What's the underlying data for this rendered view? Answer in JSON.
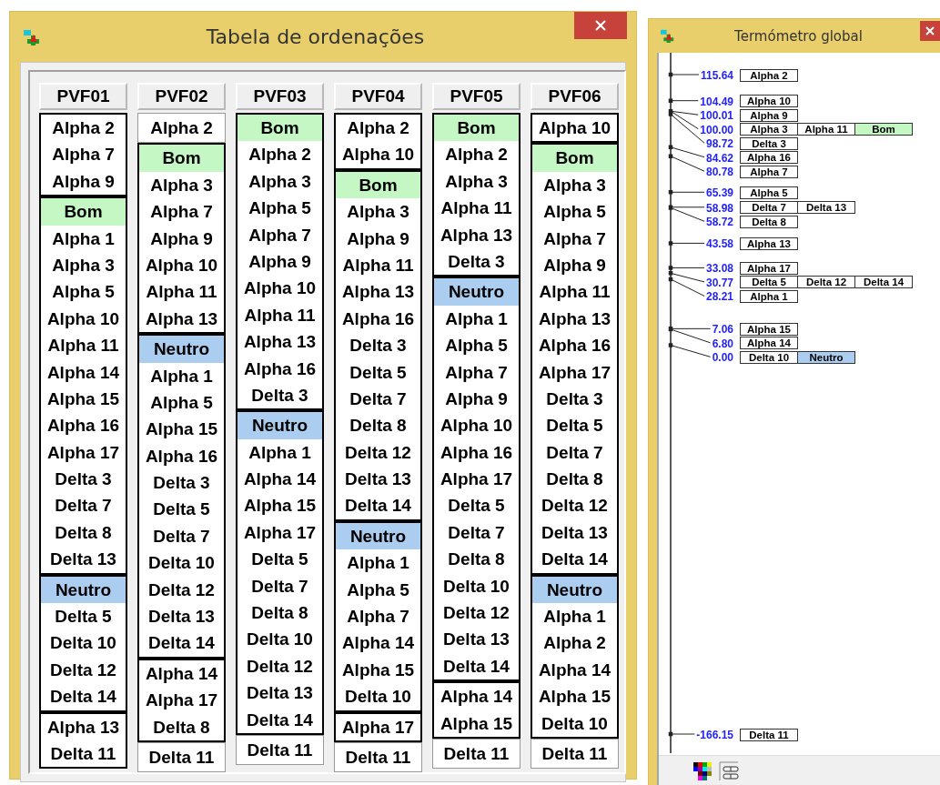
{
  "ordering_window": {
    "title": "Tabela de ordenações",
    "columns": [
      {
        "header": "PVF01",
        "groups": [
          {
            "boxed": true,
            "items": [
              {
                "label": "Alpha 2"
              },
              {
                "label": "Alpha 7"
              },
              {
                "label": "Alpha 9"
              }
            ]
          },
          {
            "boxed": true,
            "items": [
              {
                "label": "Bom",
                "color": "#c4f7c4"
              },
              {
                "label": "Alpha 1"
              },
              {
                "label": "Alpha 3"
              },
              {
                "label": "Alpha 5"
              },
              {
                "label": "Alpha 10"
              },
              {
                "label": "Alpha 11"
              },
              {
                "label": "Alpha 14"
              },
              {
                "label": "Alpha 15"
              },
              {
                "label": "Alpha 16"
              },
              {
                "label": "Alpha 17"
              },
              {
                "label": "Delta 3"
              },
              {
                "label": "Delta 7"
              },
              {
                "label": "Delta 8"
              },
              {
                "label": "Delta 13"
              }
            ]
          },
          {
            "boxed": true,
            "items": [
              {
                "label": "Neutro",
                "color": "#aacdf0"
              },
              {
                "label": "Delta 5"
              },
              {
                "label": "Delta 10"
              },
              {
                "label": "Delta 12"
              },
              {
                "label": "Delta 14"
              }
            ]
          },
          {
            "boxed": true,
            "items": [
              {
                "label": "Alpha 13"
              },
              {
                "label": "Delta 11"
              }
            ]
          }
        ]
      },
      {
        "header": "PVF02",
        "groups": [
          {
            "boxed": false,
            "items": [
              {
                "label": "Alpha 2"
              }
            ]
          },
          {
            "boxed": true,
            "items": [
              {
                "label": "Bom",
                "color": "#c4f7c4"
              },
              {
                "label": "Alpha 3"
              },
              {
                "label": "Alpha 7"
              },
              {
                "label": "Alpha 9"
              },
              {
                "label": "Alpha 10"
              },
              {
                "label": "Alpha 11"
              },
              {
                "label": "Alpha 13"
              }
            ]
          },
          {
            "boxed": true,
            "items": [
              {
                "label": "Neutro",
                "color": "#aacdf0"
              },
              {
                "label": "Alpha 1"
              },
              {
                "label": "Alpha 5"
              },
              {
                "label": "Alpha 15"
              },
              {
                "label": "Alpha 16"
              },
              {
                "label": "Delta 3"
              },
              {
                "label": "Delta 5"
              },
              {
                "label": "Delta 7"
              },
              {
                "label": "Delta 10"
              },
              {
                "label": "Delta 12"
              },
              {
                "label": "Delta 13"
              },
              {
                "label": "Delta 14"
              }
            ]
          },
          {
            "boxed": true,
            "items": [
              {
                "label": "Alpha 14"
              },
              {
                "label": "Alpha 17"
              },
              {
                "label": "Delta 8"
              }
            ]
          },
          {
            "boxed": false,
            "items": [
              {
                "label": "Delta 11"
              }
            ]
          }
        ]
      },
      {
        "header": "PVF03",
        "groups": [
          {
            "boxed": true,
            "items": [
              {
                "label": "Bom",
                "color": "#c4f7c4"
              },
              {
                "label": "Alpha 2"
              },
              {
                "label": "Alpha 3"
              },
              {
                "label": "Alpha 5"
              },
              {
                "label": "Alpha 7"
              },
              {
                "label": "Alpha 9"
              },
              {
                "label": "Alpha 10"
              },
              {
                "label": "Alpha 11"
              },
              {
                "label": "Alpha 13"
              },
              {
                "label": "Alpha 16"
              },
              {
                "label": "Delta 3"
              }
            ]
          },
          {
            "boxed": true,
            "items": [
              {
                "label": "Neutro",
                "color": "#aacdf0"
              },
              {
                "label": "Alpha 1"
              },
              {
                "label": "Alpha 14"
              },
              {
                "label": "Alpha 15"
              },
              {
                "label": "Alpha 17"
              },
              {
                "label": "Delta 5"
              },
              {
                "label": "Delta 7"
              },
              {
                "label": "Delta 8"
              },
              {
                "label": "Delta 10"
              },
              {
                "label": "Delta 12"
              },
              {
                "label": "Delta 13"
              },
              {
                "label": "Delta 14"
              }
            ]
          },
          {
            "boxed": false,
            "items": [
              {
                "label": "Delta 11"
              }
            ]
          }
        ]
      },
      {
        "header": "PVF04",
        "groups": [
          {
            "boxed": true,
            "items": [
              {
                "label": "Alpha 2"
              },
              {
                "label": "Alpha 10"
              }
            ]
          },
          {
            "boxed": true,
            "items": [
              {
                "label": "Bom",
                "color": "#c4f7c4"
              },
              {
                "label": "Alpha 3"
              },
              {
                "label": "Alpha 9"
              },
              {
                "label": "Alpha 11"
              },
              {
                "label": "Alpha 13"
              },
              {
                "label": "Alpha 16"
              },
              {
                "label": "Delta 3"
              },
              {
                "label": "Delta 5"
              },
              {
                "label": "Delta 7"
              },
              {
                "label": "Delta 8"
              },
              {
                "label": "Delta 12"
              },
              {
                "label": "Delta 13"
              },
              {
                "label": "Delta 14"
              }
            ]
          },
          {
            "boxed": true,
            "items": [
              {
                "label": "Neutro",
                "color": "#aacdf0"
              },
              {
                "label": "Alpha 1"
              },
              {
                "label": "Alpha 5"
              },
              {
                "label": "Alpha 7"
              },
              {
                "label": "Alpha 14"
              },
              {
                "label": "Alpha 15"
              },
              {
                "label": "Delta 10"
              }
            ]
          },
          {
            "boxed": true,
            "items": [
              {
                "label": "Alpha 17"
              }
            ]
          },
          {
            "boxed": false,
            "items": [
              {
                "label": "Delta 11"
              }
            ]
          }
        ]
      },
      {
        "header": "PVF05",
        "groups": [
          {
            "boxed": true,
            "items": [
              {
                "label": "Bom",
                "color": "#c4f7c4"
              },
              {
                "label": "Alpha 2"
              },
              {
                "label": "Alpha 3"
              },
              {
                "label": "Alpha 11"
              },
              {
                "label": "Alpha 13"
              },
              {
                "label": "Delta 3"
              }
            ]
          },
          {
            "boxed": true,
            "items": [
              {
                "label": "Neutro",
                "color": "#aacdf0"
              },
              {
                "label": "Alpha 1"
              },
              {
                "label": "Alpha 5"
              },
              {
                "label": "Alpha 7"
              },
              {
                "label": "Alpha 9"
              },
              {
                "label": "Alpha 10"
              },
              {
                "label": "Alpha 16"
              },
              {
                "label": "Alpha 17"
              },
              {
                "label": "Delta 5"
              },
              {
                "label": "Delta 7"
              },
              {
                "label": "Delta 8"
              },
              {
                "label": "Delta 10"
              },
              {
                "label": "Delta 12"
              },
              {
                "label": "Delta 13"
              },
              {
                "label": "Delta 14"
              }
            ]
          },
          {
            "boxed": true,
            "items": [
              {
                "label": "Alpha 14"
              },
              {
                "label": "Alpha 15"
              }
            ]
          },
          {
            "boxed": false,
            "items": [
              {
                "label": "Delta 11"
              }
            ]
          }
        ]
      },
      {
        "header": "PVF06",
        "groups": [
          {
            "boxed": true,
            "items": [
              {
                "label": "Alpha 10"
              }
            ]
          },
          {
            "boxed": true,
            "items": [
              {
                "label": "Bom",
                "color": "#c4f7c4"
              },
              {
                "label": "Alpha 3"
              },
              {
                "label": "Alpha 5"
              },
              {
                "label": "Alpha 7"
              },
              {
                "label": "Alpha 9"
              },
              {
                "label": "Alpha 11"
              },
              {
                "label": "Alpha 13"
              },
              {
                "label": "Alpha 16"
              },
              {
                "label": "Alpha 17"
              },
              {
                "label": "Delta 3"
              },
              {
                "label": "Delta 5"
              },
              {
                "label": "Delta 7"
              },
              {
                "label": "Delta 8"
              },
              {
                "label": "Delta 12"
              },
              {
                "label": "Delta 13"
              },
              {
                "label": "Delta 14"
              }
            ]
          },
          {
            "boxed": true,
            "items": [
              {
                "label": "Neutro",
                "color": "#aacdf0"
              },
              {
                "label": "Alpha 1"
              },
              {
                "label": "Alpha 2"
              },
              {
                "label": "Alpha 14"
              },
              {
                "label": "Alpha 15"
              },
              {
                "label": "Delta 10"
              }
            ]
          },
          {
            "boxed": false,
            "items": [
              {
                "label": "Delta 11"
              }
            ]
          }
        ]
      }
    ]
  },
  "thermometer_window": {
    "title": "Termómetro global",
    "entries": [
      {
        "value": "115.64",
        "items": [
          {
            "label": "Alpha 2"
          }
        ]
      },
      {
        "value": "104.49",
        "items": [
          {
            "label": "Alpha 10"
          }
        ]
      },
      {
        "value": "100.01",
        "items": [
          {
            "label": "Alpha 9"
          }
        ]
      },
      {
        "value": "100.00",
        "items": [
          {
            "label": "Alpha 3"
          },
          {
            "label": "Alpha 11"
          },
          {
            "label": "Bom",
            "color": "#c4f7c4"
          }
        ]
      },
      {
        "value": "98.72",
        "items": [
          {
            "label": "Delta 3"
          }
        ]
      },
      {
        "value": "84.62",
        "items": [
          {
            "label": "Alpha 16"
          }
        ]
      },
      {
        "value": "80.78",
        "items": [
          {
            "label": "Alpha 7"
          }
        ]
      },
      {
        "value": "65.39",
        "items": [
          {
            "label": "Alpha 5"
          }
        ]
      },
      {
        "value": "58.98",
        "items": [
          {
            "label": "Delta 7"
          },
          {
            "label": "Delta 13"
          }
        ]
      },
      {
        "value": "58.72",
        "items": [
          {
            "label": "Delta 8"
          }
        ]
      },
      {
        "value": "43.58",
        "items": [
          {
            "label": "Alpha 13"
          }
        ]
      },
      {
        "value": "33.08",
        "items": [
          {
            "label": "Alpha 17"
          }
        ]
      },
      {
        "value": "30.77",
        "items": [
          {
            "label": "Delta 5"
          },
          {
            "label": "Delta 12"
          },
          {
            "label": "Delta 14"
          }
        ]
      },
      {
        "value": "28.21",
        "items": [
          {
            "label": "Alpha 1"
          }
        ]
      },
      {
        "value": "7.06",
        "items": [
          {
            "label": "Alpha 15"
          }
        ]
      },
      {
        "value": "6.80",
        "items": [
          {
            "label": "Alpha 14"
          }
        ]
      },
      {
        "value": "0.00",
        "items": [
          {
            "label": "Delta 10"
          },
          {
            "label": "Neutro",
            "color": "#aacdf0"
          }
        ]
      },
      {
        "value": "-166.15",
        "items": [
          {
            "label": "Delta 11"
          }
        ]
      }
    ]
  }
}
